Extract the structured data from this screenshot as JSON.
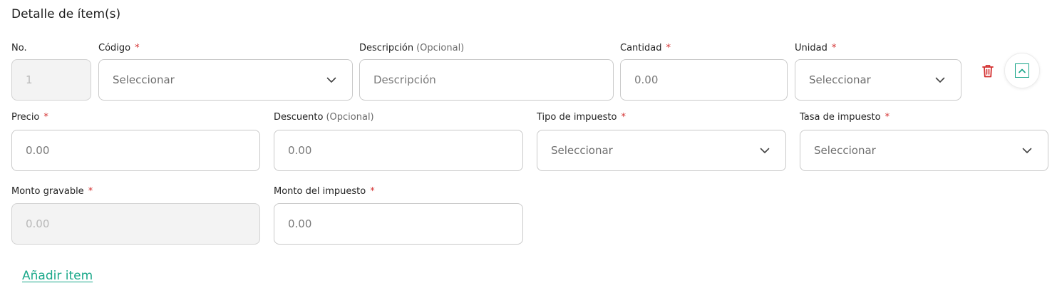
{
  "section": {
    "title": "Detalle de ítem(s)",
    "add_item_label": "Añadir item"
  },
  "row1": {
    "no": {
      "label": "No.",
      "value": "1"
    },
    "codigo": {
      "label": "Código",
      "required": "*",
      "value": "Seleccionar"
    },
    "descripcion": {
      "label": "Descripción",
      "optional": "(Opcional)",
      "placeholder": "Descripción"
    },
    "cantidad": {
      "label": "Cantidad",
      "required": "*",
      "placeholder": "0.00"
    },
    "unidad": {
      "label": "Unidad",
      "required": "*",
      "value": "Seleccionar"
    }
  },
  "row2": {
    "precio": {
      "label": "Precio",
      "required": "*",
      "placeholder": "0.00"
    },
    "descuento": {
      "label": "Descuento",
      "optional": "(Opcional)",
      "placeholder": "0.00"
    },
    "tipo_impuesto": {
      "label": "Tipo de impuesto",
      "required": "*",
      "value": "Seleccionar"
    },
    "tasa_impuesto": {
      "label": "Tasa de impuesto",
      "required": "*",
      "value": "Seleccionar"
    }
  },
  "row3": {
    "monto_gravable": {
      "label": "Monto gravable",
      "required": "*",
      "placeholder": "0.00"
    },
    "monto_impuesto": {
      "label": "Monto del impuesto",
      "required": "*",
      "placeholder": "0.00"
    }
  },
  "icons": {
    "delete": "trash-icon",
    "collapse": "chevron-up-icon",
    "dropdown": "chevron-down-icon"
  },
  "colors": {
    "accent": "#1aa88a",
    "required": "#d32f2f",
    "delete": "#d32f2f",
    "border": "#c9c9c9",
    "disabled_bg": "#f3f3f3"
  }
}
